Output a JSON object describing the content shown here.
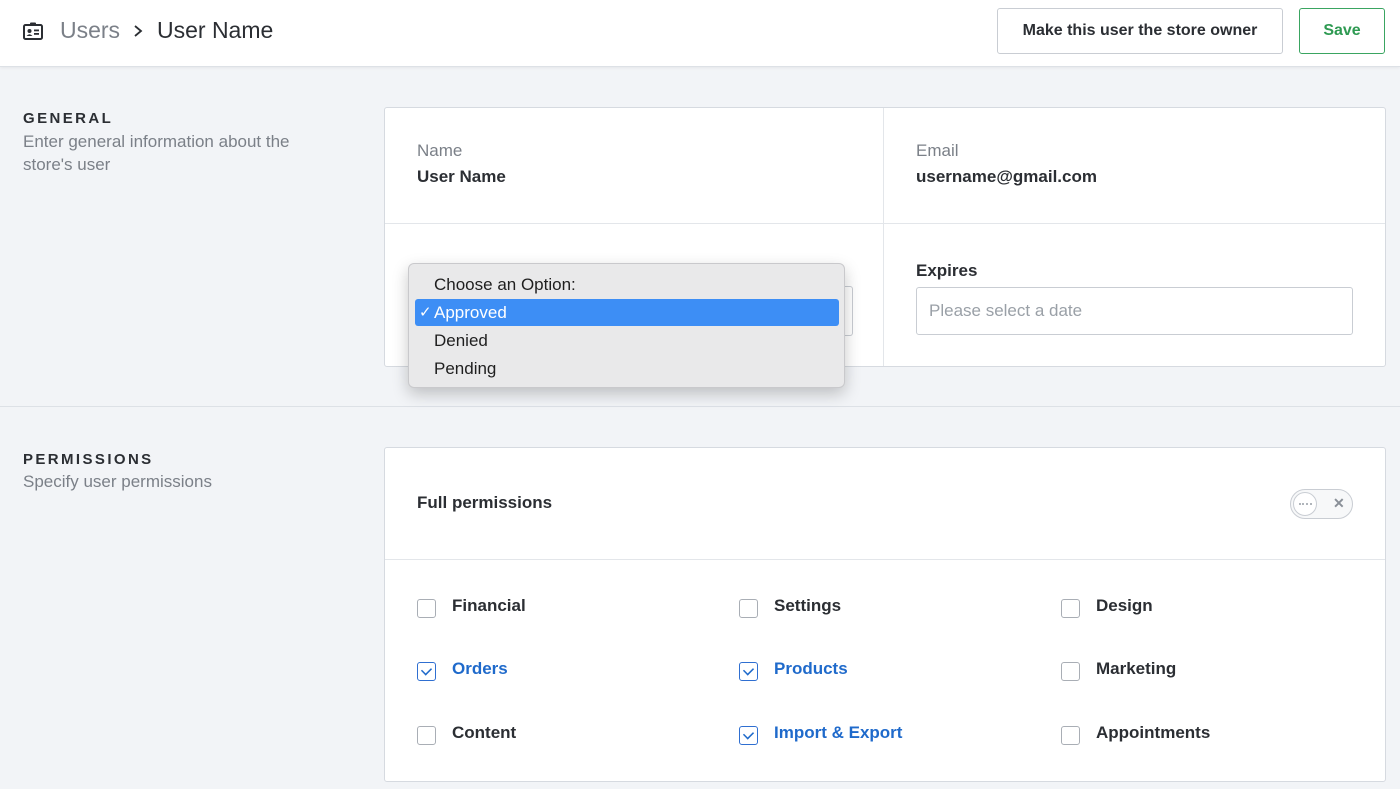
{
  "header": {
    "icon": "user-card-icon",
    "breadcrumb_root": "Users",
    "breadcrumb_current": "User Name",
    "owner_button": "Make this user the store owner",
    "save_button": "Save",
    "save_color": "#2e9a52"
  },
  "general": {
    "title": "GENERAL",
    "description": "Enter general information about the store's user",
    "name_label": "Name",
    "name_value": "User Name",
    "email_label": "Email",
    "email_value": "username@gmail.com",
    "status_dropdown": {
      "prompt": "Choose an Option:",
      "options": [
        "Approved",
        "Denied",
        "Pending"
      ],
      "selected": "Approved",
      "check_glyph": "✓"
    },
    "expires_label": "Expires",
    "expires_placeholder": "Please select a date"
  },
  "permissions": {
    "title": "PERMISSIONS",
    "description": "Specify user permissions",
    "full_label": "Full permissions",
    "full_enabled": false,
    "accent_color": "#1f6acb",
    "items": [
      {
        "label": "Financial",
        "checked": false
      },
      {
        "label": "Settings",
        "checked": false
      },
      {
        "label": "Design",
        "checked": false
      },
      {
        "label": "Orders",
        "checked": true
      },
      {
        "label": "Products",
        "checked": true
      },
      {
        "label": "Marketing",
        "checked": false
      },
      {
        "label": "Content",
        "checked": false
      },
      {
        "label": "Import & Export",
        "checked": true
      },
      {
        "label": "Appointments",
        "checked": false
      }
    ]
  }
}
